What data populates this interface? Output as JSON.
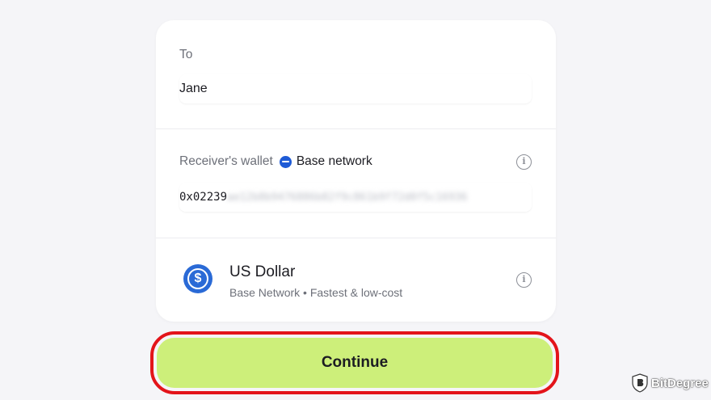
{
  "recipient": {
    "label": "To",
    "name": "Jane"
  },
  "wallet": {
    "label": "Receiver's wallet",
    "network_icon": "base-network-icon",
    "network_name": "Base network",
    "address_visible": "0x02239",
    "address_hidden": "ae12b8b9476886b82f9c861b9f72d0f5c16936",
    "info_icon": "info-icon"
  },
  "asset": {
    "icon": "usd-coin-icon",
    "name": "US Dollar",
    "subtitle": "Base Network • Fastest & low-cost",
    "info_icon": "info-icon"
  },
  "actions": {
    "continue_label": "Continue"
  },
  "watermark": {
    "text": "BitDegree"
  },
  "colors": {
    "background": "#f5f5f8",
    "button": "#cdef7a",
    "highlight": "#e3141a",
    "network_blue": "#1e5bd6"
  }
}
